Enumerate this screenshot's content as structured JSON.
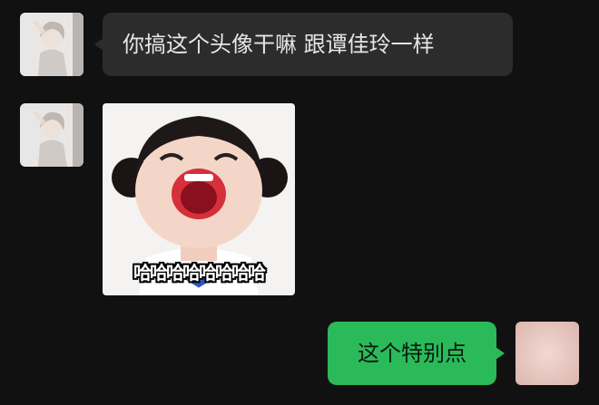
{
  "chat": {
    "messages": [
      {
        "sender": "other",
        "type": "text",
        "text": "你搞这个头像干嘛 跟谭佳玲一样"
      },
      {
        "sender": "other",
        "type": "sticker",
        "sticker_caption": "哈哈哈哈哈哈哈哈"
      },
      {
        "sender": "self",
        "type": "text",
        "text": "这个特别点"
      }
    ]
  },
  "colors": {
    "background": "#111111",
    "incoming_bubble": "#2c2c2c",
    "outgoing_bubble": "#2aba59"
  }
}
